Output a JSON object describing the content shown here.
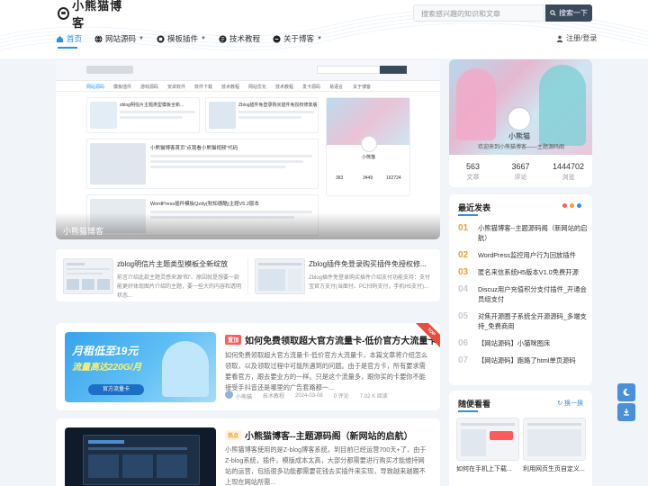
{
  "header": {
    "logo_text": "小熊猫博客",
    "search_placeholder": "搜索感兴趣的知识和文章",
    "search_button": "搜索一下",
    "login_label": "注册/登录"
  },
  "nav": {
    "items": [
      {
        "label": "首页",
        "icon": "home-icon"
      },
      {
        "label": "网站源码",
        "icon": "globe-icon"
      },
      {
        "label": "模板插件",
        "icon": "puzzle-icon"
      },
      {
        "label": "技术教程",
        "icon": "book-icon"
      },
      {
        "label": "关于博客",
        "icon": "info-icon"
      }
    ]
  },
  "slider": {
    "caption": "小熊猫博客",
    "shot_nav": [
      "网站源码",
      "模板插件",
      "游戏源码",
      "安卓软件",
      "软件下载",
      "技术教程",
      "网站优化",
      "技术教程",
      "发卡源码",
      "易语言",
      "关于博客"
    ],
    "shot_cards": [
      "zblog明信片主题类型模板全新...",
      "Zblog插件免登录购买插件免授权修复版",
      "小熊猫博客首页“点我看小熊猫视频”代码",
      "WordPress插件模板Qzdy(秋知德酷)主题V5.2版本"
    ],
    "shot_stats": [
      "383",
      "3449",
      "162724"
    ],
    "shot_profile_name": "小熊猫"
  },
  "mini_cards": [
    {
      "title": "zblog明信片主题类型模板全新绽放",
      "desc": "前言介绍此款主题灵感来源“和”、原因就是想要一款能更好体现图片介绍的主题，要一些大的内容和透明状态..."
    },
    {
      "title": "Zblog插件免登录购买插件免授权修...",
      "desc": "Zblog插件免登录购买插件介绍支付功能支持：支付宝官方支付(当面付、PC扫码支付，手机H5支付)..."
    }
  ],
  "posts": [
    {
      "tag": "置顶",
      "title": "如何免费领取超大官方流量卡-低价官方大流量卡",
      "desc": "如何免费领取超大官方流量卡-低价官方大流量卡，本篇文章将介绍怎么领取，以及领取过程中可能所遇到的问题。由于是官方卡，所有要求需要看官方，跟去要业方的一样。只是这个流量多，跟你买的卡要你不能接受手抖音还是哪里的广告套路都一...",
      "author": "小熊猫",
      "category": "技术教程",
      "date": "2024-03-08",
      "comments": "0 评论",
      "views": "7.02 K 阅读",
      "ribbon": "TOP",
      "img_line1": "月租低至19元",
      "img_line2": "流量高达220G/月",
      "img_badge": "官方流量卡"
    },
    {
      "tag": "热点",
      "title": "小熊猫博客--主题源码阁（新网站的启航）",
      "desc": "小熊猫博客使用的是Z-blog博客系统，到目前已经运营700天+了，由于Z-blog系统，插件，模版成本太高，大部分都需要进行购买才能维持网站的运营，包括很多功能都需要花钱去买插件来实现，导致越来越跟不上现在网站所需..."
    }
  ],
  "profile": {
    "name": "小熊猫",
    "desc": "欢迎来到小熊猫博客——主题源码阁",
    "stats": [
      {
        "value": "563",
        "label": "文章"
      },
      {
        "value": "3667",
        "label": "评论"
      },
      {
        "value": "1444702",
        "label": "浏览"
      }
    ]
  },
  "recent": {
    "title": "最近发表",
    "items": [
      {
        "num": "01",
        "text": "小熊猫博客--主题源码阁（新网站的启航）"
      },
      {
        "num": "02",
        "text": "WordPress监控用户行为回放插件"
      },
      {
        "num": "03",
        "text": "匿名来信系统H5版本V1.0免费开源"
      },
      {
        "num": "04",
        "text": "Discuz用户充值积分支付插件_开通会员组支付"
      },
      {
        "num": "05",
        "text": "对焦开源圈子系统全开源源码_多端支持_免费商用"
      },
      {
        "num": "06",
        "text": "【网站源码】小猫咪图床"
      },
      {
        "num": "07",
        "text": "【网站源码】跑路了html单页源码"
      }
    ]
  },
  "random": {
    "title": "随便看看",
    "refresh": "换一换",
    "items": [
      {
        "caption": "如何在手机上下载..."
      },
      {
        "caption": "利用网页生页自定义..."
      }
    ]
  },
  "colors": {
    "accent": "#2f8fe6",
    "search_button": "#394a5c",
    "tag_top": "#ff5b5b",
    "tag_hot": "#f0a030",
    "float_button": "#4a90d9"
  }
}
